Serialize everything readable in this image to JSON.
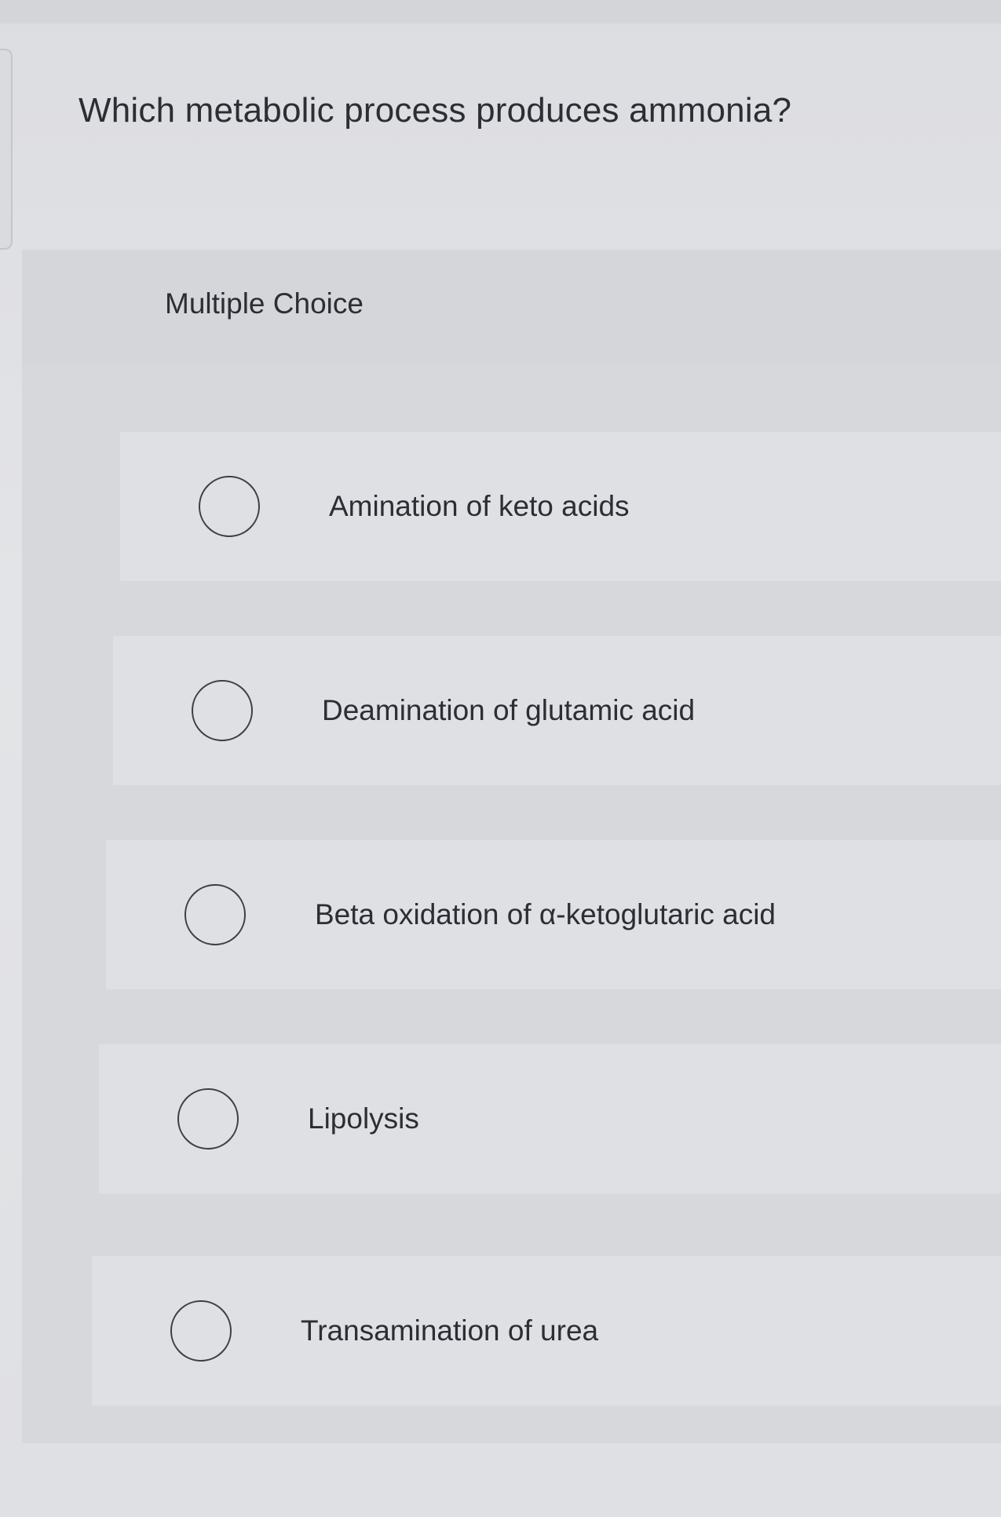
{
  "question": {
    "text": "Which metabolic process produces ammonia?"
  },
  "choice_block": {
    "label": "Multiple Choice",
    "options": [
      {
        "label": "Amination of keto acids",
        "selected": false
      },
      {
        "label": "Deamination of glutamic acid",
        "selected": false
      },
      {
        "label": "Beta oxidation of α-ketoglutaric acid",
        "selected": false
      },
      {
        "label": "Lipolysis",
        "selected": false
      },
      {
        "label": "Transamination of urea",
        "selected": false
      }
    ]
  },
  "colors": {
    "page_background": "#dfe0e3",
    "panel_background": "#d6d8dc",
    "option_background": "#dfe0e3",
    "text": "#2c2e35",
    "radio_border": "#3c3f46"
  }
}
